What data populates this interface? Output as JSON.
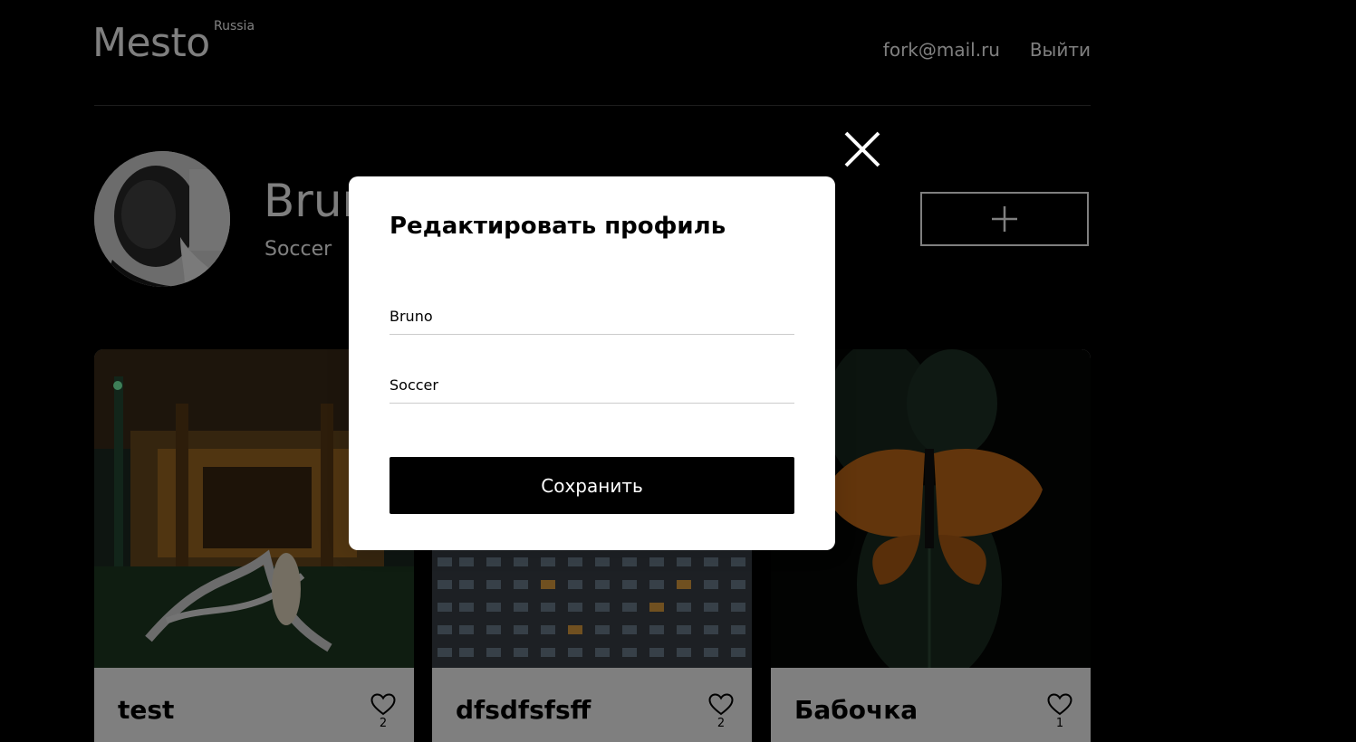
{
  "header": {
    "logo": "Mesto",
    "logo_sup": "Russia",
    "email": "fork@mail.ru",
    "logout_label": "Выйти"
  },
  "profile": {
    "name": "Bruno",
    "job": "Soccer",
    "avatar_icon": "person-photo",
    "add_icon": "plus-icon"
  },
  "cards": [
    {
      "title": "test",
      "likes": "2"
    },
    {
      "title": "dfsdfsfsff",
      "likes": "2"
    },
    {
      "title": "Бабочка",
      "likes": "1"
    }
  ],
  "popup": {
    "title": "Редактировать профиль",
    "name_value": "Bruno",
    "job_value": "Soccer",
    "save_label": "Сохранить",
    "close_icon": "close-icon"
  },
  "colors": {
    "background": "#000000",
    "overlay": "rgba(0,0,0,0.5)",
    "popup": "#ffffff",
    "button": "#000000"
  }
}
